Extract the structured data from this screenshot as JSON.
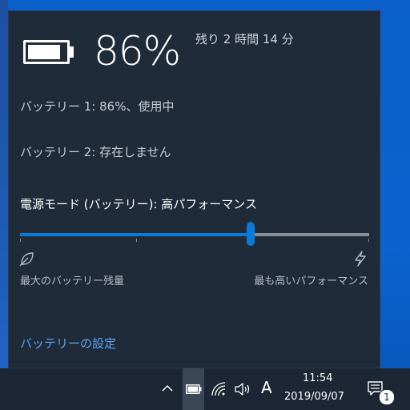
{
  "battery": {
    "percent_text": "86%",
    "level": 0.86,
    "remaining": "残り 2 時間 14 分",
    "battery1": "バッテリー 1: 86%、使用中",
    "battery2": "バッテリー 2: 存在しません"
  },
  "power_mode": {
    "label": "電源モード (バッテリー): 高パフォーマンス",
    "slider_position": 0.66,
    "left_label": "最大のバッテリー残量",
    "right_label": "最も高いパフォーマンス"
  },
  "settings_link": "バッテリーの設定",
  "taskbar": {
    "ime_label": "A",
    "time": "11:54",
    "date": "2019/09/07",
    "notification_count": "1"
  },
  "colors": {
    "accent": "#0a7ad9",
    "flyout_bg": "#202b3a",
    "taskbar_bg": "#1c2634",
    "link": "#5aa7f0"
  }
}
